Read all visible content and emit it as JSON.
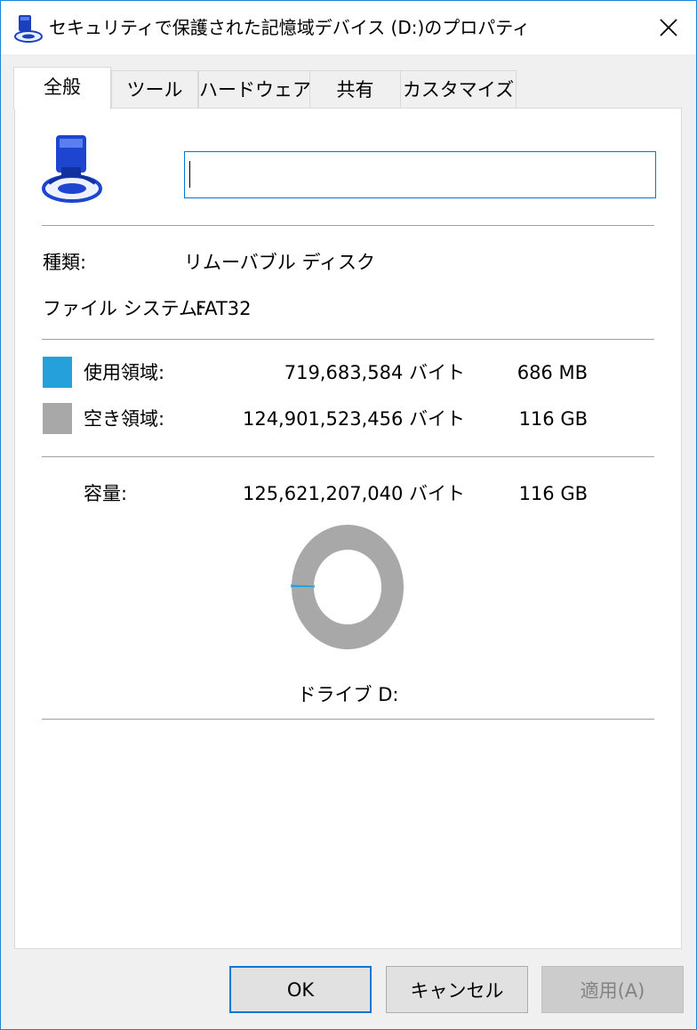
{
  "window": {
    "title": "セキュリティで保護された記憶域デバイス (D:)のプロパティ"
  },
  "tabs": [
    {
      "label": "全般"
    },
    {
      "label": "ツール"
    },
    {
      "label": "ハードウェア"
    },
    {
      "label": "共有"
    },
    {
      "label": "カスタマイズ"
    }
  ],
  "general": {
    "drive_name_value": "",
    "type_label": "種類:",
    "type_value": "リムーバブル ディスク",
    "fs_label": "ファイル システム:",
    "fs_value": "FAT32",
    "used": {
      "label": "使用領域:",
      "bytes": "719,683,584 バイト",
      "size": "686 MB",
      "color": "#26a0da"
    },
    "free": {
      "label": "空き領域:",
      "bytes": "124,901,523,456 バイト",
      "size": "116 GB",
      "color": "#a8a8a8"
    },
    "capacity": {
      "label": "容量:",
      "bytes": "125,621,207,040 バイト",
      "size": "116 GB"
    },
    "drive_label": "ドライブ D:"
  },
  "chart_data": {
    "type": "pie",
    "categories": [
      "使用領域",
      "空き領域"
    ],
    "values": [
      719683584,
      124901523456
    ],
    "colors": [
      "#26a0da",
      "#a8a8a8"
    ]
  },
  "buttons": {
    "ok": "OK",
    "cancel": "キャンセル",
    "apply": "適用(A)"
  }
}
